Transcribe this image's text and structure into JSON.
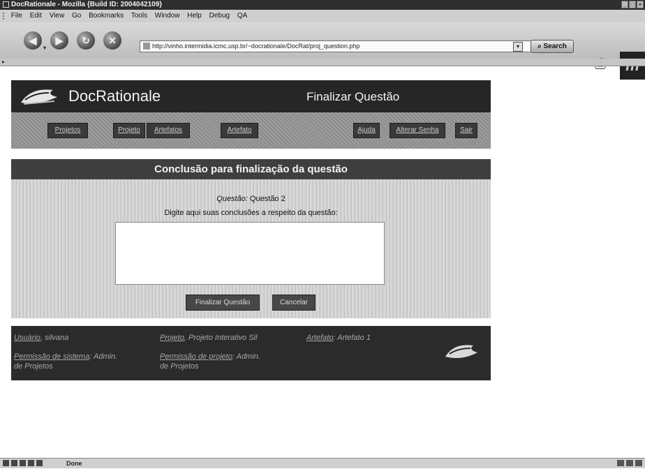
{
  "window": {
    "title": "DocRationale - Mozilla {Build ID: 2004042109}"
  },
  "menubar": {
    "items": [
      "File",
      "Edit",
      "View",
      "Go",
      "Bookmarks",
      "Tools",
      "Window",
      "Help",
      "Debug",
      "QA"
    ]
  },
  "toolbar": {
    "url": "http://vinho.intermidia.icmc.usp.br/~docrationale/DocRat/proj_question.php",
    "search_label": "Search",
    "throbber_glyph": "m"
  },
  "header": {
    "app_title": "DocRationale",
    "page_title": "Finalizar Questão"
  },
  "nav": {
    "projetos": "Projetos",
    "projeto": "Projeto",
    "artefatos": "Artefatos",
    "artefato": "Artefato",
    "ajuda": "Ajuda",
    "alterar_senha": "Alterar Senha",
    "sair": "Sair"
  },
  "section": {
    "title": "Conclusão para finalização da questão"
  },
  "form": {
    "question_label": "Questão:",
    "question_value": "Questão 2",
    "prompt": "Digite aqui suas conclusões a respeito da questão:",
    "conclusion_value": "",
    "submit_label": "Finalizar Questão",
    "cancel_label": "Cancelar"
  },
  "footer": {
    "usuario_label": "Usuário",
    "usuario_value": "silvana",
    "projeto_label": "Projeto",
    "projeto_value": "Projeto Interativo Sil",
    "artefato_label": "Artefato",
    "artefato_value": "Artefato 1",
    "perm_sistema_label": "Permissão de sistema",
    "perm_sistema_value_1": "Admin.",
    "perm_sistema_value_2": "de Projetos",
    "perm_projeto_label": "Permissão de projeto",
    "perm_projeto_value_1": "Admin.",
    "perm_projeto_value_2": "de Projetos"
  },
  "status": {
    "text": "Done"
  },
  "colors": {
    "header_bg": "#262626",
    "nav_bg": "#9d9d9d",
    "button_bg": "#3a3a3a",
    "section_bg": "#3f3f3f",
    "footer_bg": "#2b2b2b"
  }
}
